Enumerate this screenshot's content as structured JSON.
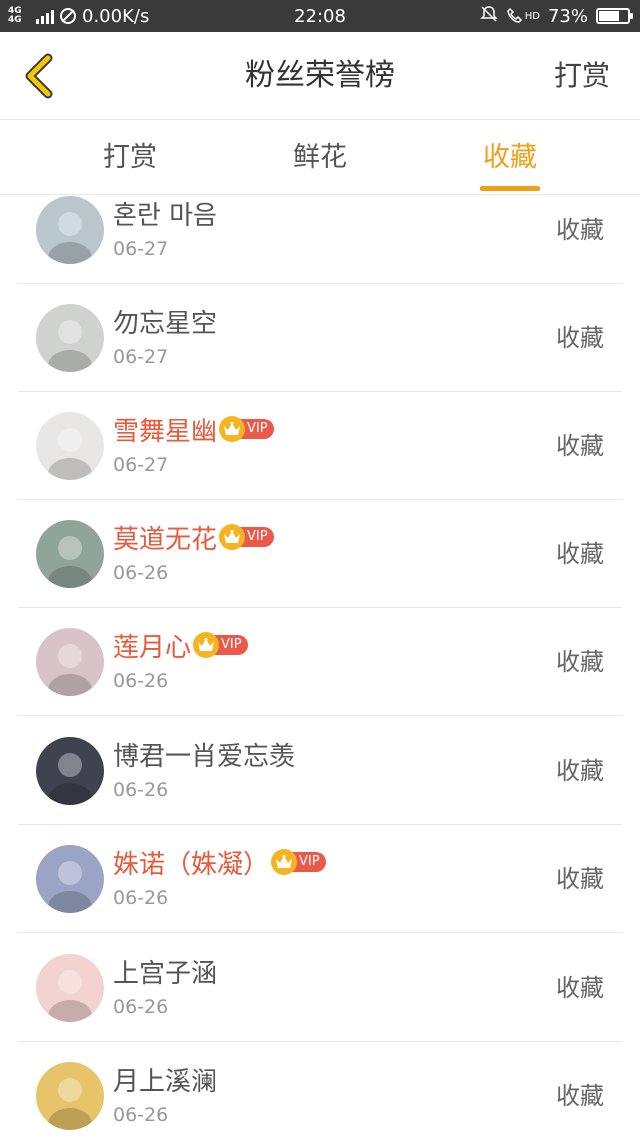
{
  "status_bar": {
    "network": "4G 4G",
    "speed": "0.00K/s",
    "time": "22:08",
    "hd": "HD",
    "battery": "73%",
    "battery_level": 0.73
  },
  "header": {
    "title": "粉丝荣誉榜",
    "action": "打赏"
  },
  "tabs": [
    {
      "label": "打赏",
      "active": false
    },
    {
      "label": "鲜花",
      "active": false
    },
    {
      "label": "收藏",
      "active": true
    }
  ],
  "vip_label": "VIP",
  "list": [
    {
      "name": "혼란 마음",
      "date": "06-27",
      "vip": false,
      "action": "收藏",
      "avatar_color": "#b9c6cc"
    },
    {
      "name": "勿忘星空",
      "date": "06-27",
      "vip": false,
      "action": "收藏",
      "avatar_color": "#cfd2cf"
    },
    {
      "name": "雪舞星幽",
      "date": "06-27",
      "vip": true,
      "action": "收藏",
      "avatar_color": "#e9e6e6"
    },
    {
      "name": "莫道无花",
      "date": "06-26",
      "vip": true,
      "action": "收藏",
      "avatar_color": "#8fa59a"
    },
    {
      "name": "莲月心",
      "date": "06-26",
      "vip": true,
      "action": "收藏",
      "avatar_color": "#d8c4c8"
    },
    {
      "name": "博君一肖爱忘羡",
      "date": "06-26",
      "vip": false,
      "action": "收藏",
      "avatar_color": "#3f4350"
    },
    {
      "name": "姝诺（姝凝）",
      "date": "06-26",
      "vip": true,
      "action": "收藏",
      "avatar_color": "#9aa4c4"
    },
    {
      "name": "上宫子涵",
      "date": "06-26",
      "vip": false,
      "action": "收藏",
      "avatar_color": "#f3d3cf"
    },
    {
      "name": "月上溪澜",
      "date": "06-26",
      "vip": false,
      "action": "收藏",
      "avatar_color": "#e7c46a"
    }
  ]
}
